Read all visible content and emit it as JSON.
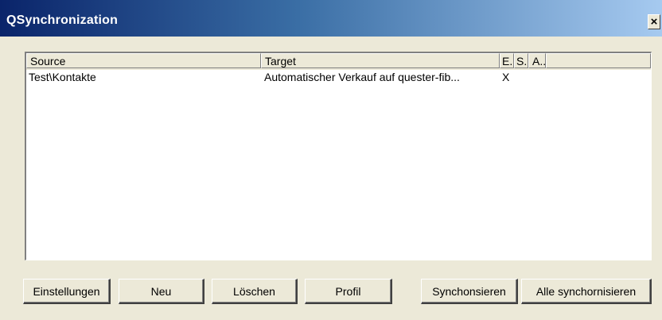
{
  "window": {
    "title": "QSynchronization",
    "close_label": "×"
  },
  "list": {
    "columns": [
      "Source",
      "Target",
      "E..",
      "S..",
      "A.."
    ],
    "rows": [
      {
        "source": "Test\\Kontakte",
        "target": "Automatischer Verkauf auf quester-fib...",
        "e": "X",
        "s": "",
        "a": ""
      }
    ]
  },
  "buttons": {
    "einstellungen": "Einstellungen",
    "neu": "Neu",
    "loeschen": "Löschen",
    "profil": "Profil",
    "synchronisieren": "Synchonsieren",
    "alle_synchronisieren": "Alle synchornisieren"
  }
}
